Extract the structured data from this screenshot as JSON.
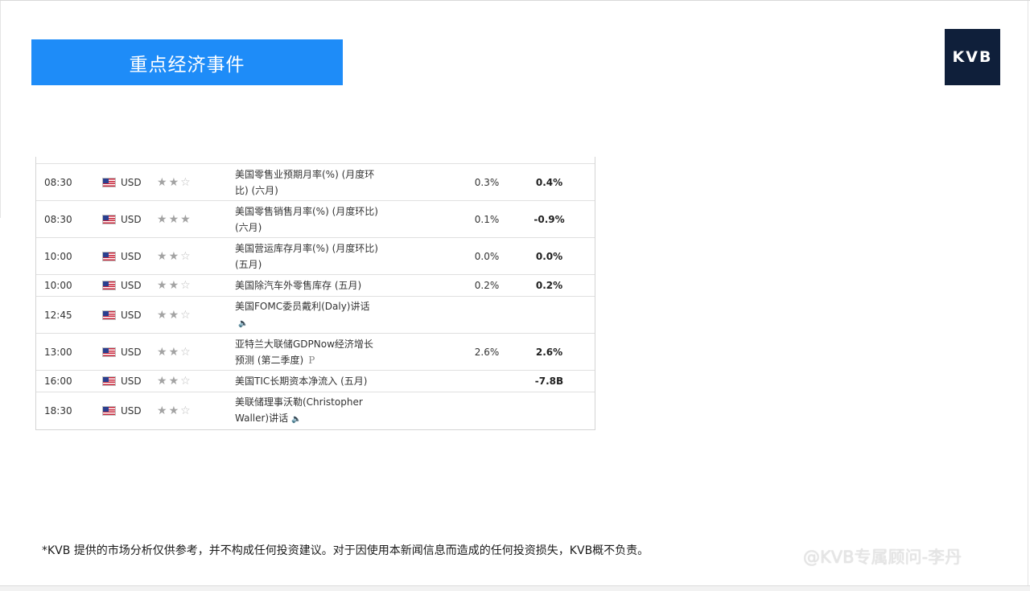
{
  "header": {
    "title": "重点经济事件"
  },
  "logo": {
    "text": "KVB"
  },
  "calendar": {
    "rows": [
      {
        "time": "08:30",
        "currency": "USD",
        "stars": 2,
        "event_lines": [
          "美国零售业预期月率(%) (月度环",
          "比) (六月)"
        ],
        "previous": "0.3%",
        "actual": "0.4%",
        "icon": ""
      },
      {
        "time": "08:30",
        "currency": "USD",
        "stars": 3,
        "event_lines": [
          "美国零售销售月率(%) (月度环比)",
          "(六月)"
        ],
        "previous": "0.1%",
        "actual": "-0.9%",
        "icon": ""
      },
      {
        "time": "10:00",
        "currency": "USD",
        "stars": 2,
        "event_lines": [
          "美国营运库存月率(%) (月度环比)",
          "(五月)"
        ],
        "previous": "0.0%",
        "actual": "0.0%",
        "icon": ""
      },
      {
        "time": "10:00",
        "currency": "USD",
        "stars": 2,
        "event_lines": [
          "美国除汽车外零售库存 (五月)"
        ],
        "previous": "0.2%",
        "actual": "0.2%",
        "icon": ""
      },
      {
        "time": "12:45",
        "currency": "USD",
        "stars": 2,
        "event_lines": [
          "美国FOMC委员戴利(Daly)讲话",
          ""
        ],
        "previous": "",
        "actual": "",
        "icon": "speaker-icon"
      },
      {
        "time": "13:00",
        "currency": "USD",
        "stars": 2,
        "event_lines": [
          "亚特兰大联储GDPNow经济增长",
          "预测 (第二季度)"
        ],
        "previous": "2.6%",
        "actual": "2.6%",
        "icon": "p-icon",
        "icon_text": "P"
      },
      {
        "time": "16:00",
        "currency": "USD",
        "stars": 2,
        "event_lines": [
          "美国TIC长期资本净流入 (五月)"
        ],
        "previous": "",
        "actual": "-7.8B",
        "icon": ""
      },
      {
        "time": "18:30",
        "currency": "USD",
        "stars": 2,
        "event_lines": [
          "美联储理事沃勒(Christopher",
          "Waller)讲话"
        ],
        "previous": "",
        "actual": "",
        "icon": "speaker-icon"
      }
    ]
  },
  "footer": {
    "disclaimer": "*KVB 提供的市场分析仅供参考，并不构成任何投资建议。对于因使用本新闻信息而造成的任何投资损失，KVB概不负责。",
    "watermark": "@KVB专属顾问-李丹"
  },
  "colors": {
    "banner": "#1e8cf8",
    "logo_bg": "#0f1f3a"
  }
}
